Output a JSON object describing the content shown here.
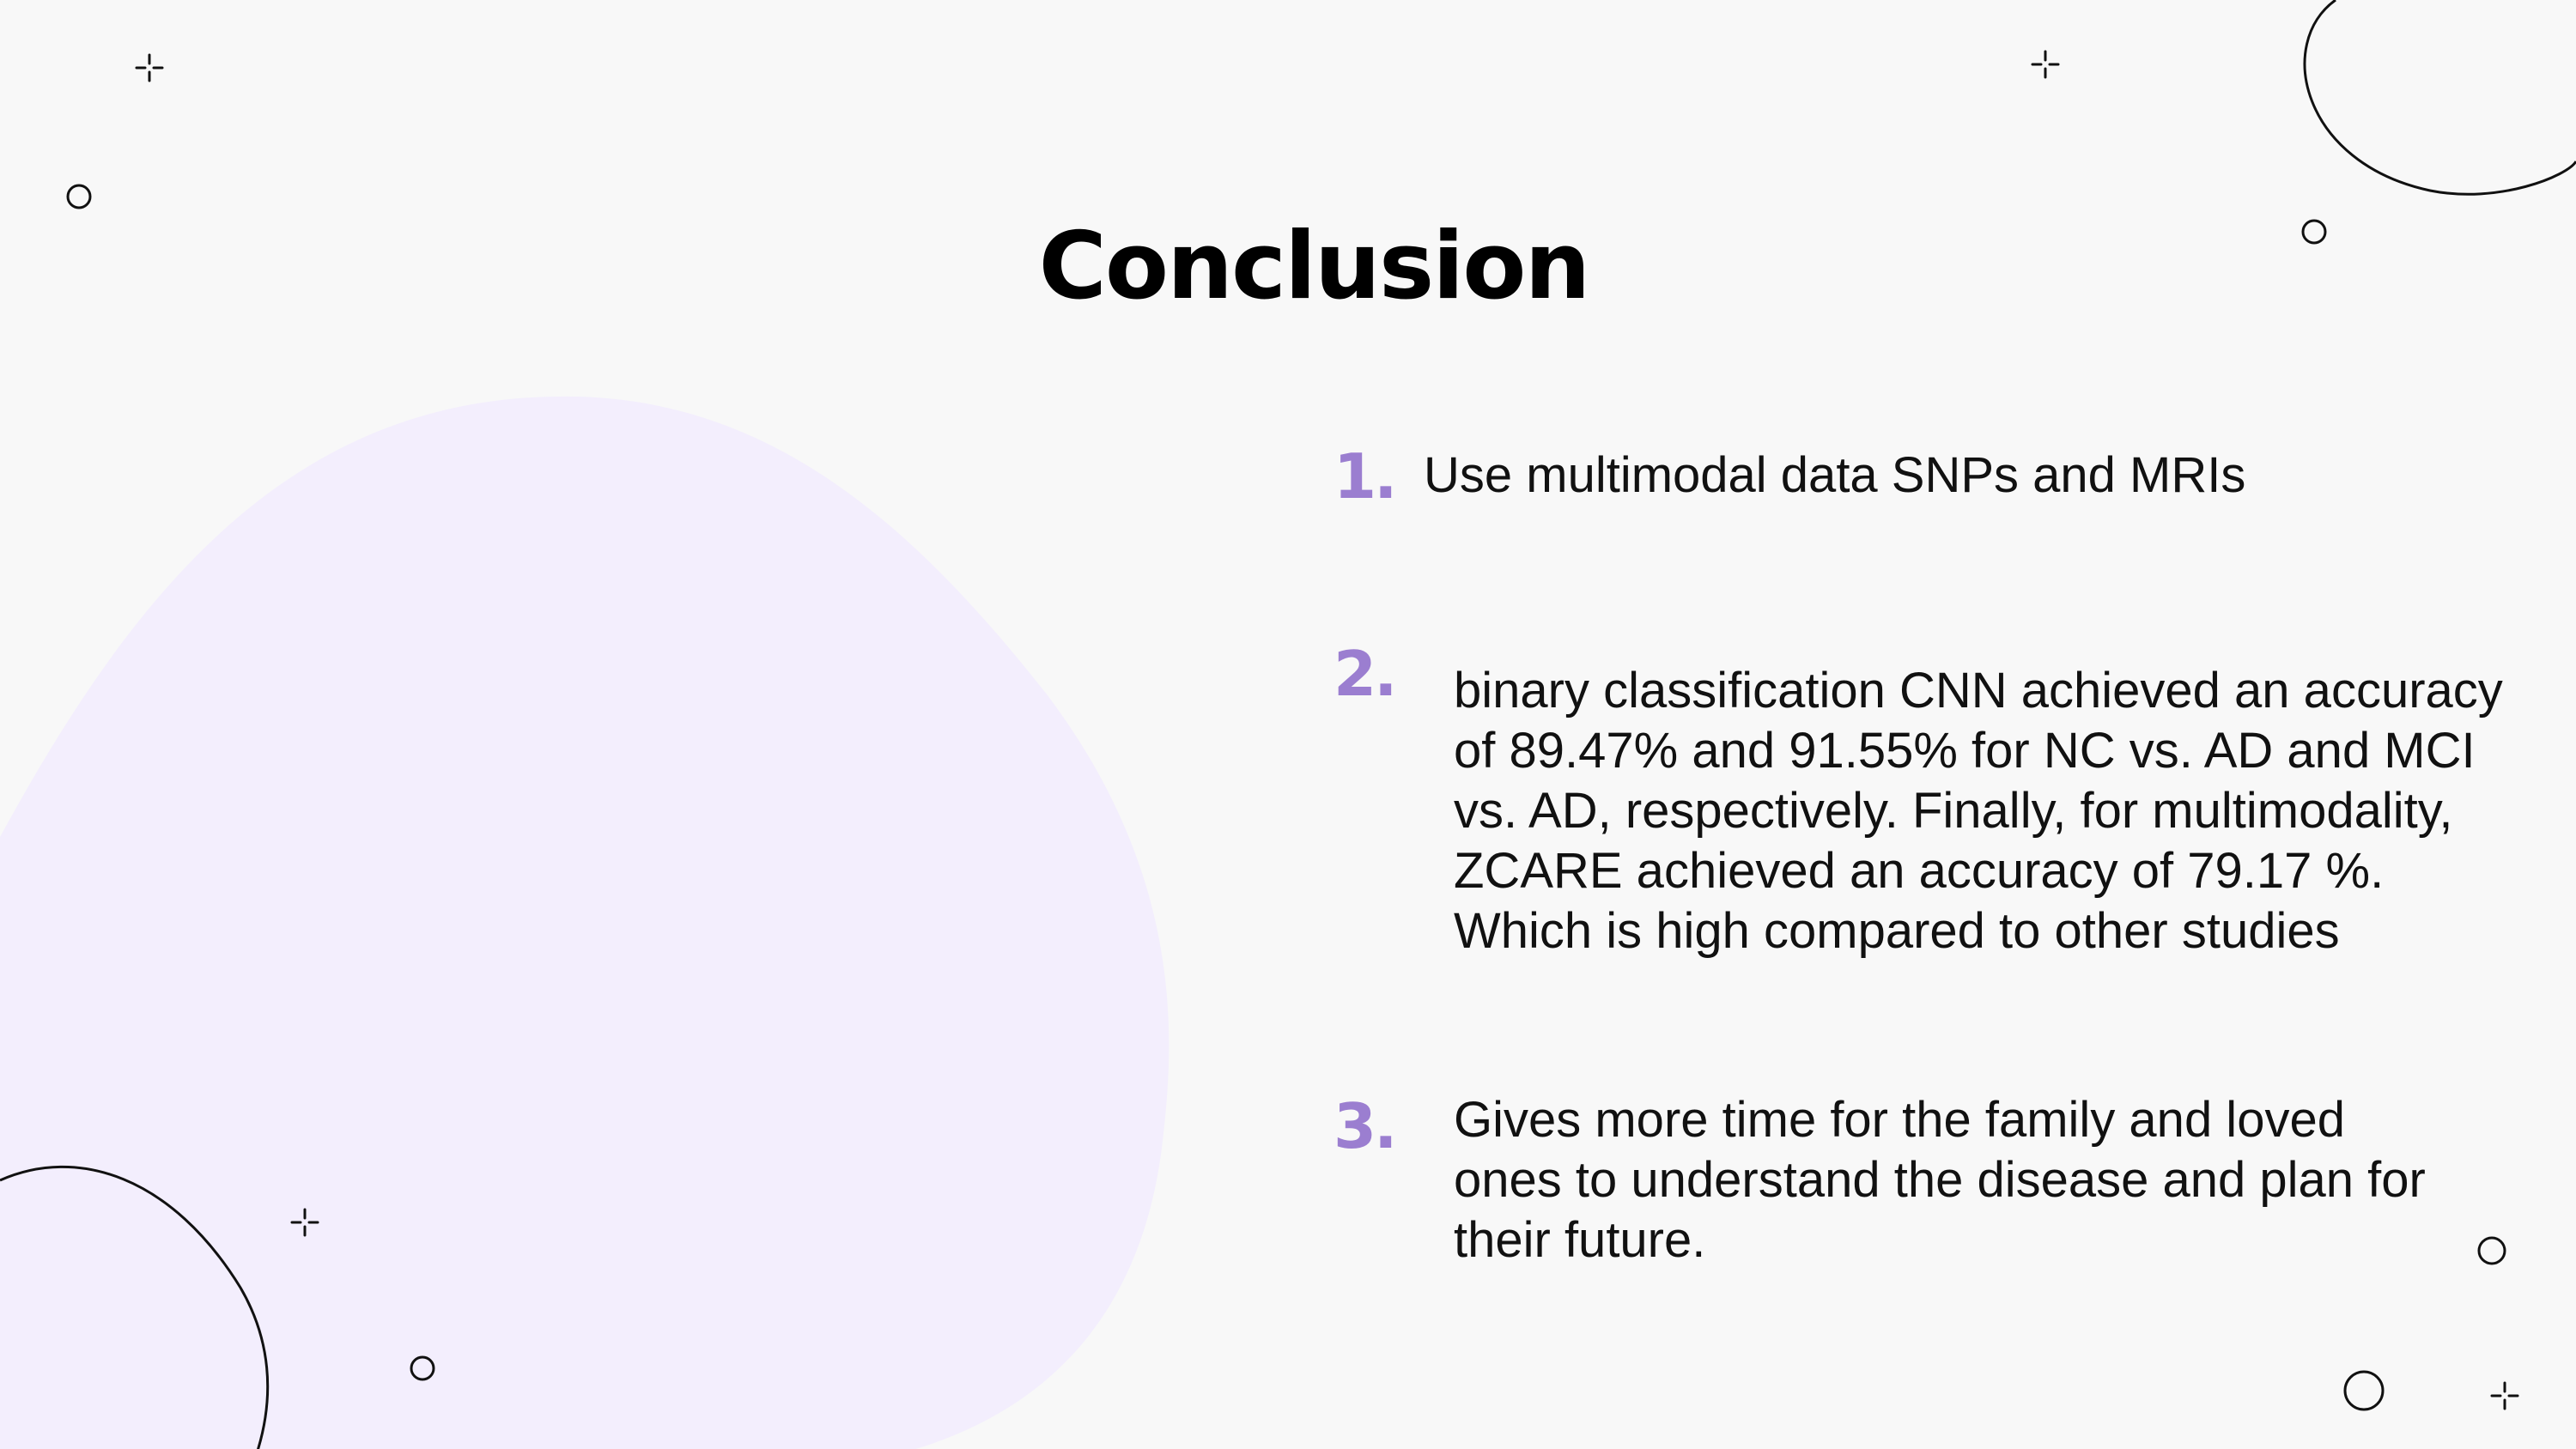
{
  "slide": {
    "title": "Conclusion",
    "items": [
      {
        "number": "1.",
        "text": "Use multimodal data SNPs and MRIs"
      },
      {
        "number": "2.",
        "text": "binary classification CNN achieved an accuracy of 89.47% and 91.55% for NC vs. AD and MCI vs. AD, respectively. Finally, for multimodality, ZCARE achieved an accuracy of 79.17 %. Which is high compared to other studies"
      },
      {
        "number": "3.",
        "text": "Gives more time for the family and loved ones to understand the disease and plan for their future."
      }
    ]
  },
  "colors": {
    "background": "#f8f8f8",
    "blob": "#f3eefd",
    "accent_number": "#9b7ed0",
    "outline": "#111111"
  }
}
